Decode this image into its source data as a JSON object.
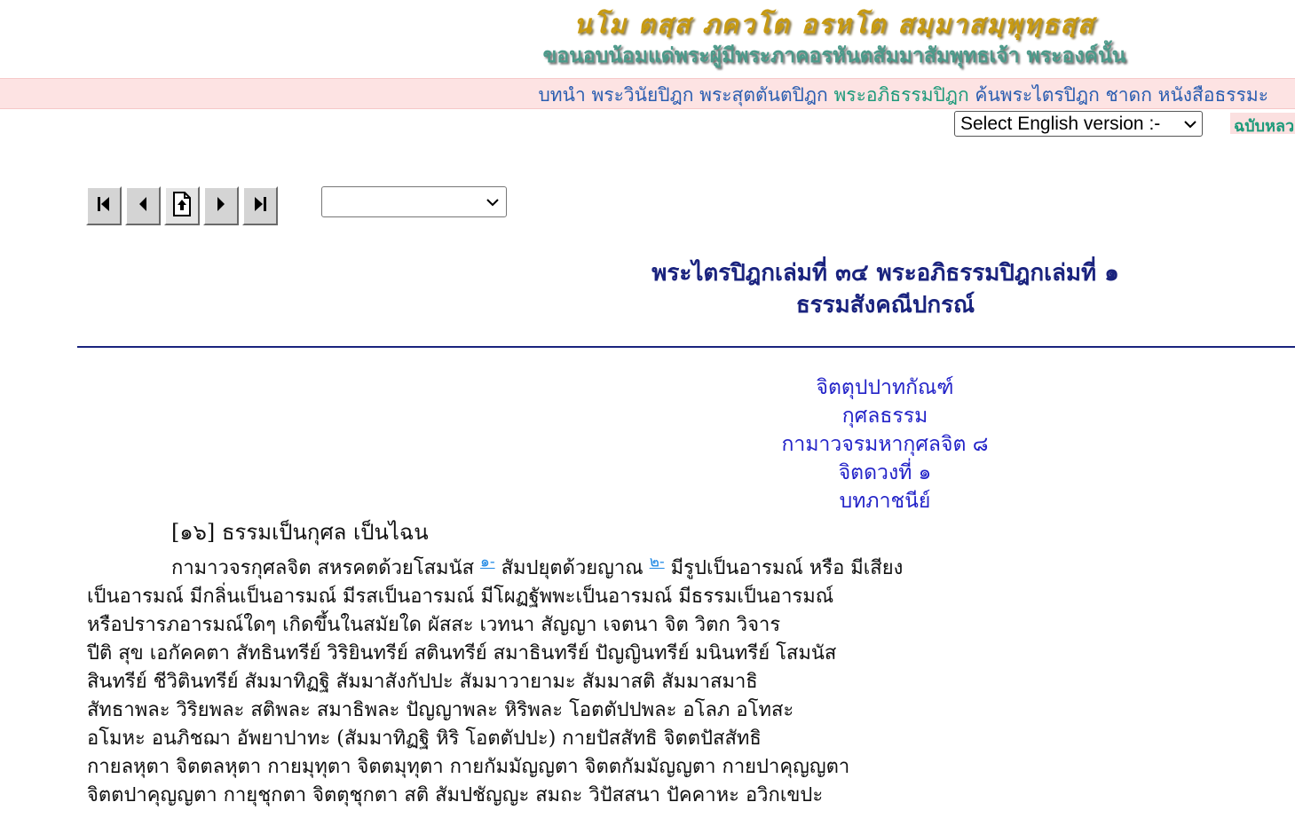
{
  "header": {
    "pali_homage": "นโม ตสฺส ภควโต อรหโต สมฺมาสมฺพุทฺธสฺส",
    "thai_homage": "ขอนอบน้อมแด่พระผู้มีพระภาคอรหันตสัมมาสัมพุทธเจ้า  พระองค์นั้น"
  },
  "nav": {
    "items": [
      {
        "label": "บทนำ",
        "active": false
      },
      {
        "label": "พระวินัยปิฎก",
        "active": false
      },
      {
        "label": "พระสุตตันตปิฎก",
        "active": false
      },
      {
        "label": "พระอภิธรรมปิฎก",
        "active": true
      },
      {
        "label": "ค้นพระไตรปิฎก",
        "active": false
      },
      {
        "label": "ชาดก",
        "active": false
      },
      {
        "label": "หนังสือธรรมะ",
        "active": false
      }
    ]
  },
  "language_select": {
    "selected": "Select English version :-"
  },
  "edition_tag": "ฉบับหลวง",
  "toolbar": {
    "buttons": [
      "first-page-icon",
      "previous-page-icon",
      "page-index-icon",
      "next-page-icon",
      "last-page-icon"
    ]
  },
  "page_select": {
    "selected": ""
  },
  "title": {
    "line1": "พระไตรปิฎกเล่มที่ ๓๔ พระอภิธรรมปิฎกเล่มที่ ๑",
    "line2": "ธรรมสังคณีปกรณ์"
  },
  "sections": [
    "จิตตุปปาทกัณฑ์",
    "กุศลธรรม",
    "กามาวจรมหากุศลจิต ๘",
    "จิตดวงที่ ๑",
    "บทภาชนีย์"
  ],
  "paragraph_head": "[๑๖] ธรรมเป็นกุศล เป็นไฉน",
  "body": {
    "first_line_a": "กามาวจรกุศลจิต สหรคตด้วยโสมนัส",
    "footnote1": "๑-",
    "first_line_b": "สัมปยุตด้วยญาณ",
    "footnote2": "๒-",
    "first_line_c": "มีรูปเป็นอารมณ์ หรือ มีเสียง",
    "lines": [
      "เป็นอารมณ์ มีกลิ่นเป็นอารมณ์ มีรสเป็นอารมณ์ มีโผฏฐัพพะเป็นอารมณ์ มีธรรมเป็นอารมณ์",
      "หรือปรารภอารมณ์ใดๆ เกิดขึ้นในสมัยใด ผัสสะ เวทนา สัญญา เจตนา จิต วิตก วิจาร",
      "ปีติ สุข เอกัคคตา สัทธินทรีย์ วิริยินทรีย์ สตินทรีย์ สมาธินทรีย์ ปัญญินทรีย์ มนินทรีย์ โสมนัส",
      "สินทรีย์ ชีวิตินทรีย์ สัมมาทิฏฐิ สัมมาสังกัปปะ สัมมาวายามะ สัมมาสติ สัมมาสมาธิ",
      "สัทธาพละ วิริยพละ สติพละ สมาธิพละ ปัญญาพละ หิริพละ โอตตัปปพละ อโลภ อโทสะ",
      "อโมหะ อนภิชฌา อัพยาปาทะ (สัมมาทิฏฐิ หิริ โอตตัปปะ) กายปัสสัทธิ จิตตปัสสัทธิ",
      "กายลหุตา จิตตลหุตา กายมุทุตา จิตตมุทุตา กายกัมมัญญตา จิตตกัมมัญญตา กายปาคุญญตา",
      "จิตตปาคุญญตา กายุชุกตา จิตตุชุกตา สติ สัมปชัญญะ สมถะ วิปัสสนา ปัคคาหะ อวิกเขปะ"
    ]
  }
}
